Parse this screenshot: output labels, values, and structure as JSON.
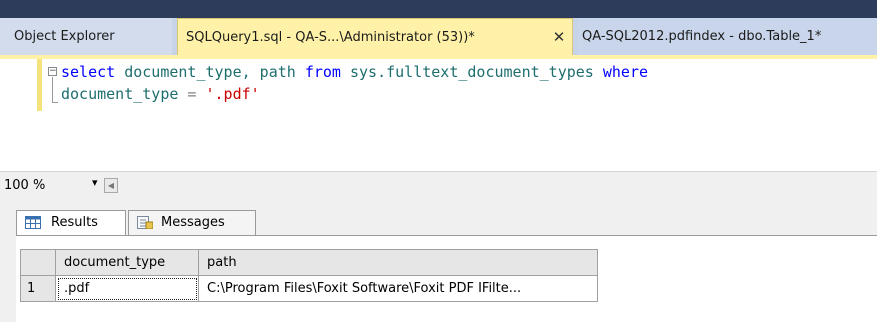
{
  "tabs": {
    "explorer": "Object Explorer",
    "active": "SQLQuery1.sql - QA-S...\\Administrator (53))*",
    "active_close": "✕",
    "other": "QA-SQL2012.pdfindex - dbo.Table_1*"
  },
  "editor": {
    "line1": {
      "kw_select": "select",
      "text1": " document_type, path ",
      "kw_from": "from",
      "text2": " sys.fulltext_document_types ",
      "kw_where": "where"
    },
    "line2": {
      "ident": "document_type",
      "op": " = ",
      "literal": "'.pdf'"
    }
  },
  "zoom": {
    "value": "100 %",
    "arrow": "▾"
  },
  "result_tabs": {
    "results": "Results",
    "messages": "Messages"
  },
  "grid": {
    "columns": [
      "document_type",
      "path"
    ],
    "rows": [
      {
        "num": "1",
        "document_type": ".pdf",
        "path": "C:\\Program Files\\Foxit Software\\Foxit PDF IFilte..."
      }
    ]
  },
  "colors": {
    "active_tab": "#fff2a8",
    "keyword": "#0000ff",
    "string": "#cc0000"
  }
}
